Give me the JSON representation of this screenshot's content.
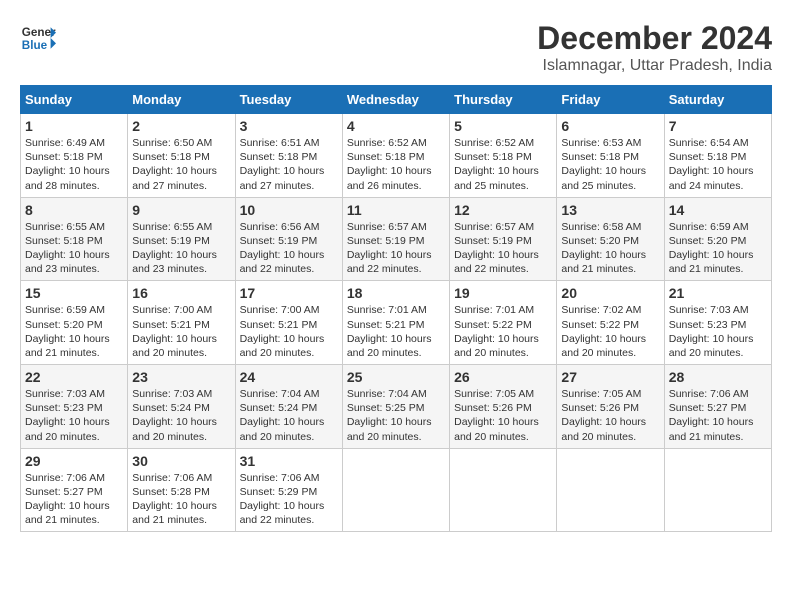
{
  "logo": {
    "line1": "General",
    "line2": "Blue"
  },
  "title": "December 2024",
  "subtitle": "Islamnagar, Uttar Pradesh, India",
  "days_of_week": [
    "Sunday",
    "Monday",
    "Tuesday",
    "Wednesday",
    "Thursday",
    "Friday",
    "Saturday"
  ],
  "weeks": [
    [
      {
        "day": "1",
        "sunrise": "6:49 AM",
        "sunset": "5:18 PM",
        "daylight": "10 hours and 28 minutes."
      },
      {
        "day": "2",
        "sunrise": "6:50 AM",
        "sunset": "5:18 PM",
        "daylight": "10 hours and 27 minutes."
      },
      {
        "day": "3",
        "sunrise": "6:51 AM",
        "sunset": "5:18 PM",
        "daylight": "10 hours and 27 minutes."
      },
      {
        "day": "4",
        "sunrise": "6:52 AM",
        "sunset": "5:18 PM",
        "daylight": "10 hours and 26 minutes."
      },
      {
        "day": "5",
        "sunrise": "6:52 AM",
        "sunset": "5:18 PM",
        "daylight": "10 hours and 25 minutes."
      },
      {
        "day": "6",
        "sunrise": "6:53 AM",
        "sunset": "5:18 PM",
        "daylight": "10 hours and 25 minutes."
      },
      {
        "day": "7",
        "sunrise": "6:54 AM",
        "sunset": "5:18 PM",
        "daylight": "10 hours and 24 minutes."
      }
    ],
    [
      {
        "day": "8",
        "sunrise": "6:55 AM",
        "sunset": "5:18 PM",
        "daylight": "10 hours and 23 minutes."
      },
      {
        "day": "9",
        "sunrise": "6:55 AM",
        "sunset": "5:19 PM",
        "daylight": "10 hours and 23 minutes."
      },
      {
        "day": "10",
        "sunrise": "6:56 AM",
        "sunset": "5:19 PM",
        "daylight": "10 hours and 22 minutes."
      },
      {
        "day": "11",
        "sunrise": "6:57 AM",
        "sunset": "5:19 PM",
        "daylight": "10 hours and 22 minutes."
      },
      {
        "day": "12",
        "sunrise": "6:57 AM",
        "sunset": "5:19 PM",
        "daylight": "10 hours and 22 minutes."
      },
      {
        "day": "13",
        "sunrise": "6:58 AM",
        "sunset": "5:20 PM",
        "daylight": "10 hours and 21 minutes."
      },
      {
        "day": "14",
        "sunrise": "6:59 AM",
        "sunset": "5:20 PM",
        "daylight": "10 hours and 21 minutes."
      }
    ],
    [
      {
        "day": "15",
        "sunrise": "6:59 AM",
        "sunset": "5:20 PM",
        "daylight": "10 hours and 21 minutes."
      },
      {
        "day": "16",
        "sunrise": "7:00 AM",
        "sunset": "5:21 PM",
        "daylight": "10 hours and 20 minutes."
      },
      {
        "day": "17",
        "sunrise": "7:00 AM",
        "sunset": "5:21 PM",
        "daylight": "10 hours and 20 minutes."
      },
      {
        "day": "18",
        "sunrise": "7:01 AM",
        "sunset": "5:21 PM",
        "daylight": "10 hours and 20 minutes."
      },
      {
        "day": "19",
        "sunrise": "7:01 AM",
        "sunset": "5:22 PM",
        "daylight": "10 hours and 20 minutes."
      },
      {
        "day": "20",
        "sunrise": "7:02 AM",
        "sunset": "5:22 PM",
        "daylight": "10 hours and 20 minutes."
      },
      {
        "day": "21",
        "sunrise": "7:03 AM",
        "sunset": "5:23 PM",
        "daylight": "10 hours and 20 minutes."
      }
    ],
    [
      {
        "day": "22",
        "sunrise": "7:03 AM",
        "sunset": "5:23 PM",
        "daylight": "10 hours and 20 minutes."
      },
      {
        "day": "23",
        "sunrise": "7:03 AM",
        "sunset": "5:24 PM",
        "daylight": "10 hours and 20 minutes."
      },
      {
        "day": "24",
        "sunrise": "7:04 AM",
        "sunset": "5:24 PM",
        "daylight": "10 hours and 20 minutes."
      },
      {
        "day": "25",
        "sunrise": "7:04 AM",
        "sunset": "5:25 PM",
        "daylight": "10 hours and 20 minutes."
      },
      {
        "day": "26",
        "sunrise": "7:05 AM",
        "sunset": "5:26 PM",
        "daylight": "10 hours and 20 minutes."
      },
      {
        "day": "27",
        "sunrise": "7:05 AM",
        "sunset": "5:26 PM",
        "daylight": "10 hours and 20 minutes."
      },
      {
        "day": "28",
        "sunrise": "7:06 AM",
        "sunset": "5:27 PM",
        "daylight": "10 hours and 21 minutes."
      }
    ],
    [
      {
        "day": "29",
        "sunrise": "7:06 AM",
        "sunset": "5:27 PM",
        "daylight": "10 hours and 21 minutes."
      },
      {
        "day": "30",
        "sunrise": "7:06 AM",
        "sunset": "5:28 PM",
        "daylight": "10 hours and 21 minutes."
      },
      {
        "day": "31",
        "sunrise": "7:06 AM",
        "sunset": "5:29 PM",
        "daylight": "10 hours and 22 minutes."
      },
      null,
      null,
      null,
      null
    ]
  ],
  "labels": {
    "sunrise": "Sunrise:",
    "sunset": "Sunset:",
    "daylight": "Daylight:"
  }
}
